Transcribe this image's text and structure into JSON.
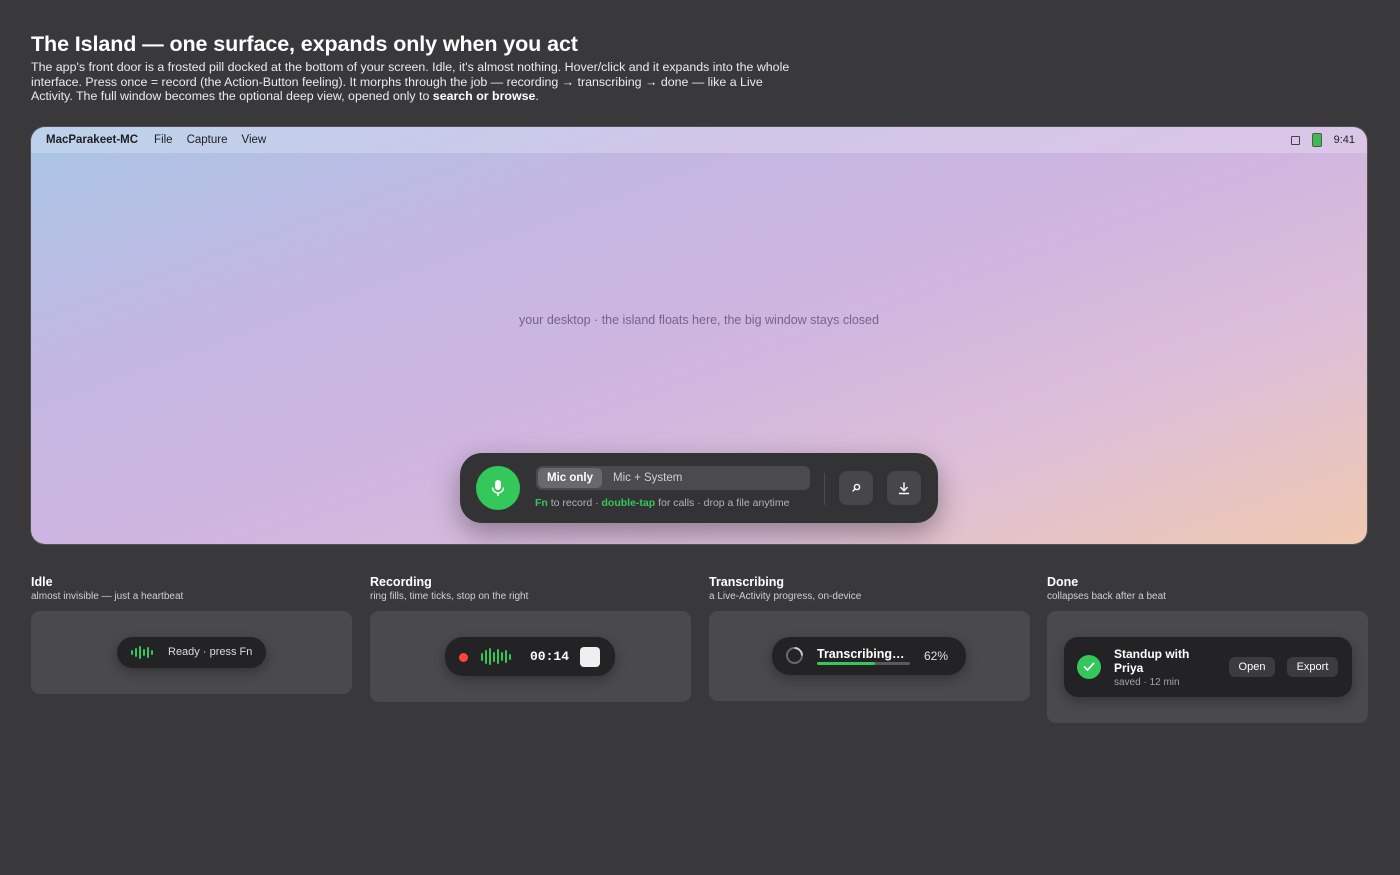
{
  "header": {
    "title": "The Island — one surface, expands only when you act",
    "desc_part1": "The app's front door is a frosted pill docked at the bottom of your screen. Idle, it's almost nothing. Hover/click and it expands into the whole interface. Press once = record (the Action-Button feeling). It morphs through the job — recording → transcribing → done — like a Live Activity. The full window becomes the optional deep view, opened only to ",
    "desc_bold": "search or browse",
    "desc_part2": "."
  },
  "menubar": {
    "app_name": "MacParakeet-MC",
    "menus": [
      "File",
      "Capture",
      "View"
    ],
    "clock": "9:41"
  },
  "desktop": {
    "hint": "your desktop · the island floats here, the big window stays closed"
  },
  "island": {
    "mode_active": "Mic only",
    "mode_inactive": "Mic + System",
    "hint_key1": "Fn",
    "hint_text1": " to record · ",
    "hint_key2": "double-tap",
    "hint_text2": " for calls · drop a file anytime"
  },
  "states": {
    "idle": {
      "title": "Idle",
      "subtitle": "almost invisible — just a heartbeat",
      "pill_text": "Ready · press Fn"
    },
    "recording": {
      "title": "Recording",
      "subtitle": "ring fills, time ticks, stop on the right",
      "time": "00:14"
    },
    "transcribing": {
      "title": "Transcribing",
      "subtitle": "a Live-Activity progress, on-device",
      "label": "Transcribing…",
      "percent_text": "62%",
      "progress": 0.62
    },
    "done": {
      "title": "Done",
      "subtitle": "collapses back after a beat",
      "item_title": "Standup with Priya",
      "item_meta": "saved · 12 min",
      "open_label": "Open",
      "export_label": "Export"
    }
  },
  "colors": {
    "accent_green": "#34c759",
    "record_red": "#ff453a",
    "pill_dark": "#333336"
  },
  "icons": [
    "mic-icon",
    "search-icon",
    "download-icon",
    "waveform-icon",
    "stop-icon",
    "spinner-icon",
    "checkmark-icon",
    "battery-icon",
    "control-center-icon"
  ]
}
